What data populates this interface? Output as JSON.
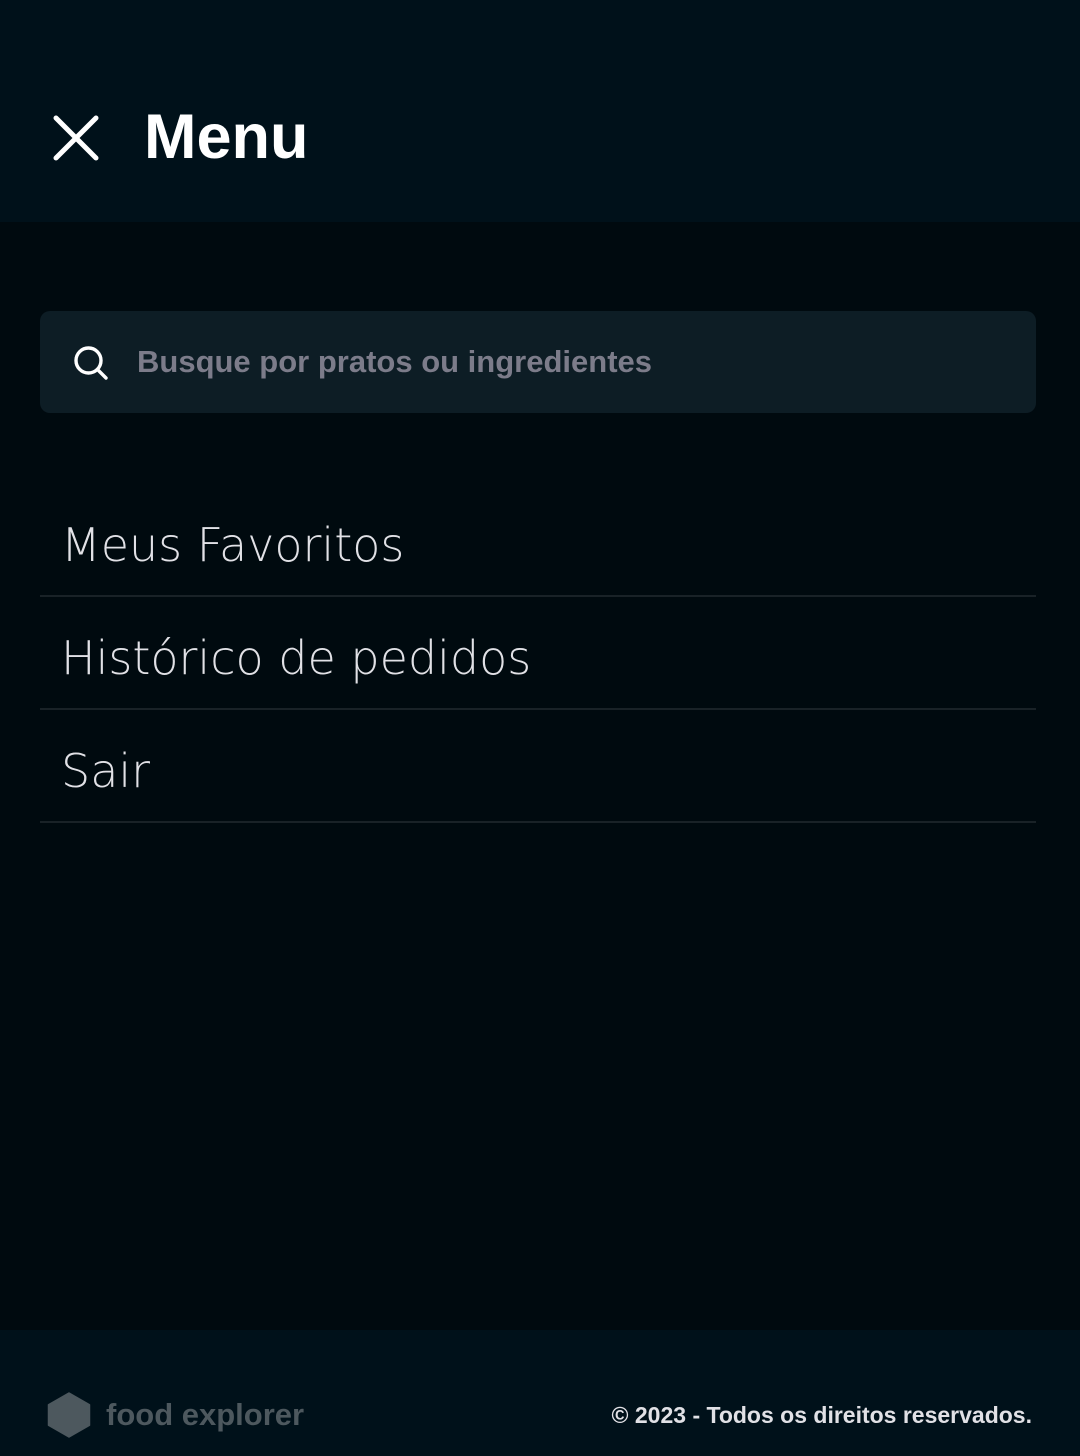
{
  "header": {
    "title": "Menu",
    "close_icon": "close-icon"
  },
  "search": {
    "placeholder": "Busque por pratos ou ingredientes",
    "value": "",
    "icon": "search-icon"
  },
  "menu": {
    "items": [
      {
        "label": "Meus Favoritos"
      },
      {
        "label": "Histórico de pedidos"
      },
      {
        "label": "Sair"
      }
    ]
  },
  "footer": {
    "brand": "food explorer",
    "logo_icon": "hexagon-icon",
    "copyright": "© 2023 - Todos os direitos reservados."
  },
  "colors": {
    "background": "#000a0f",
    "header_bg": "#00111a",
    "search_bg": "#0d1d25",
    "divider": "#192227",
    "placeholder": "#7c7c8a",
    "logo_muted": "#4d585e",
    "text_light": "#e1e1e6"
  }
}
